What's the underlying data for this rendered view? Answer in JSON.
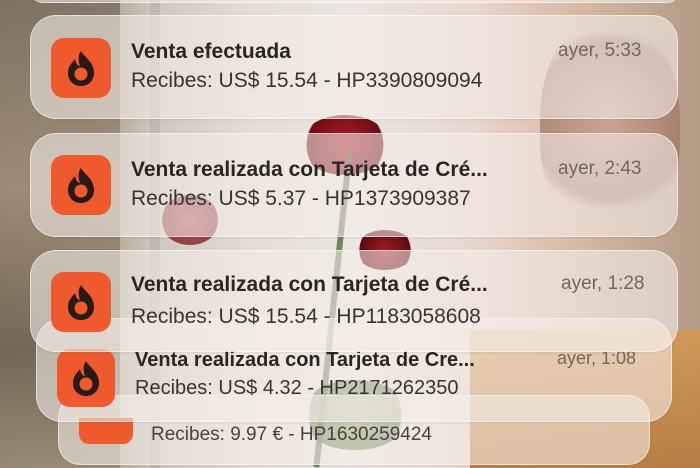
{
  "notifications": [
    {
      "title": "Venta efectuada",
      "body": "Recibes: US$ 15.54 - HP3390809094",
      "time": "ayer, 5:33",
      "icon": "hotmart-flame-icon"
    },
    {
      "title": "Venta realizada con Tarjeta de Cré...",
      "body": "Recibes: US$ 5.37 - HP1373909387",
      "time": "ayer, 2:43",
      "icon": "hotmart-flame-icon"
    },
    {
      "title": "Venta realizada con Tarjeta de Cré...",
      "body": "Recibes: US$ 15.54 - HP1183058608",
      "time": "ayer, 1:28",
      "icon": "hotmart-flame-icon"
    },
    {
      "title": "Venta realizada con Tarjeta de Cre...",
      "body": "Recibes: US$ 4.32 - HP2171262350",
      "time": "ayer, 1:08",
      "icon": "hotmart-flame-icon"
    },
    {
      "title": "",
      "body": "Recibes: 9.97 € - HP1630259424",
      "time": "",
      "icon": "hotmart-flame-icon"
    }
  ],
  "colors": {
    "icon_bg": "#ee5a2e",
    "flame": "#2a1a17"
  }
}
